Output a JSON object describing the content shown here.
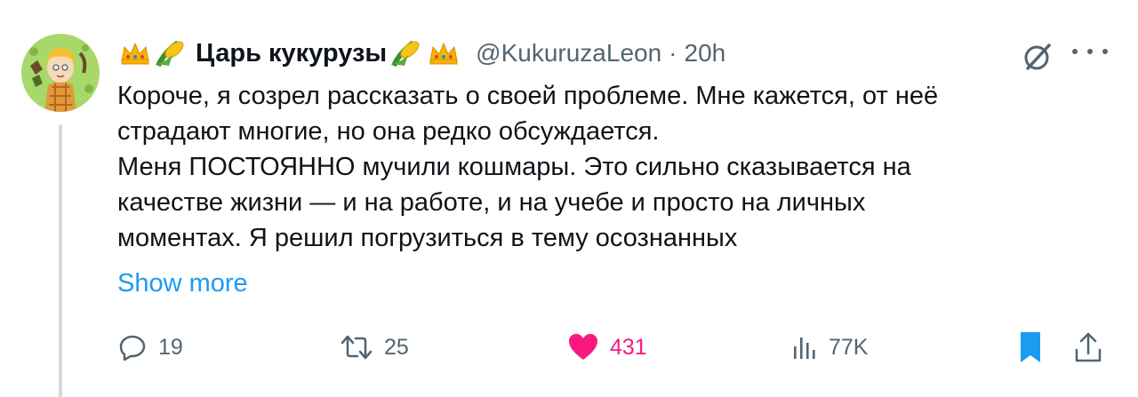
{
  "author": {
    "name": "Царь кукурузы",
    "handle": "@KukuruzaLeon",
    "separator": "·",
    "time": "20h"
  },
  "icons": {
    "left_emojis": [
      "crown-emoji-icon",
      "corn-emoji-icon"
    ],
    "right_emojis": [
      "corn-emoji-icon",
      "crown-emoji-icon"
    ],
    "grok": "grok-icon",
    "more": "more-dots-icon"
  },
  "tweet": {
    "lines": [
      "Короче, я созрел рассказать о своей проблеме. Мне кажется, от неё",
      "страдают многие, но она редко обсуждается.",
      "Меня ПОСТОЯННО мучили кошмары. Это сильно сказывается на",
      "качестве жизни — и на работе, и на учебе и просто на личных",
      "моментах. Я решил погрузиться в тему осознанных"
    ],
    "show_more": "Show more"
  },
  "actions": {
    "replies": "19",
    "retweets": "25",
    "likes": "431",
    "views": "77K"
  },
  "colors": {
    "text": "#0f1419",
    "secondary": "#536471",
    "link": "#1d9bf0",
    "like": "#f91880",
    "bookmark": "#1d9bf0",
    "thread_line": "#cfd9de"
  }
}
